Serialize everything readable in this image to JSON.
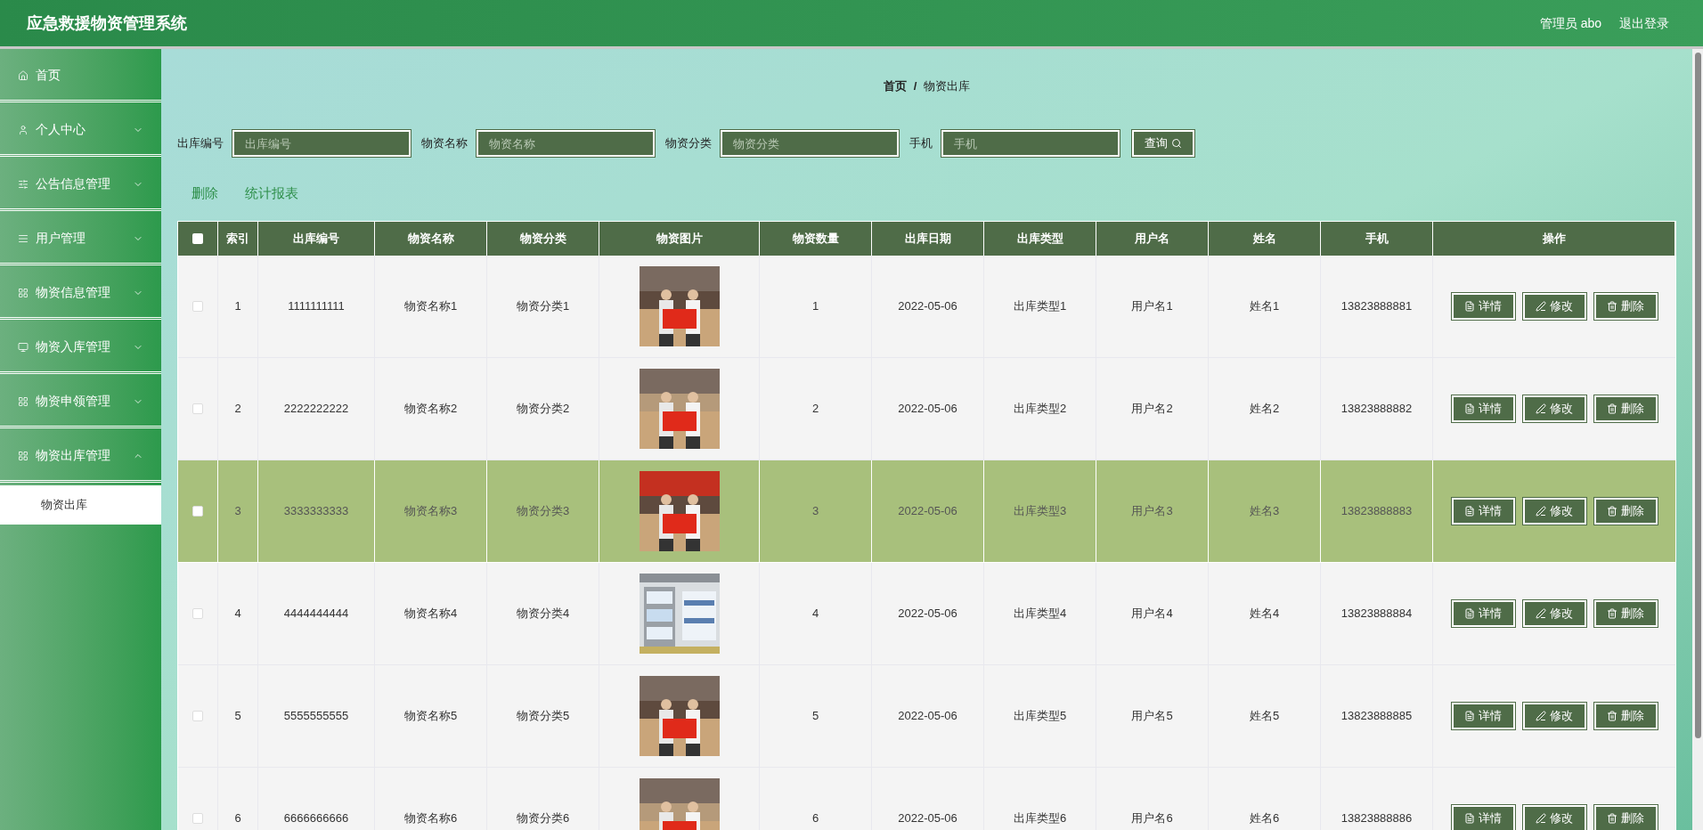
{
  "header": {
    "title": "应急救援物资管理系统",
    "user": "管理员 abo",
    "logout": "退出登录"
  },
  "sidebar": {
    "items": [
      {
        "label": "首页",
        "kind": "link"
      },
      {
        "label": "个人中心",
        "kind": "menu",
        "expanded": false
      },
      {
        "label": "公告信息管理",
        "kind": "menu",
        "expanded": false
      },
      {
        "label": "用户管理",
        "kind": "menu",
        "expanded": false
      },
      {
        "label": "物资信息管理",
        "kind": "menu",
        "expanded": false
      },
      {
        "label": "物资入库管理",
        "kind": "menu",
        "expanded": false
      },
      {
        "label": "物资申领管理",
        "kind": "menu",
        "expanded": false
      },
      {
        "label": "物资出库管理",
        "kind": "menu",
        "expanded": true,
        "children": [
          {
            "label": "物资出库",
            "selected": true
          }
        ]
      }
    ]
  },
  "breadcrumb": {
    "items": [
      "首页",
      "物资出库"
    ],
    "separator": "/"
  },
  "search": {
    "fields": [
      {
        "label": "出库编号",
        "placeholder": "出库编号"
      },
      {
        "label": "物资名称",
        "placeholder": "物资名称"
      },
      {
        "label": "物资分类",
        "placeholder": "物资分类"
      },
      {
        "label": "手机",
        "placeholder": "手机"
      }
    ],
    "button": "查询"
  },
  "actions": [
    "删除",
    "统计报表"
  ],
  "table": {
    "header_checkbox": {
      "checked": false
    },
    "columns": [
      "索引",
      "出库编号",
      "物资名称",
      "物资分类",
      "物资图片",
      "物资数量",
      "出库日期",
      "出库类型",
      "用户名",
      "姓名",
      "手机",
      "操作"
    ],
    "rows": [
      {
        "selected": false,
        "checked": false,
        "cells": [
          "1",
          "1111111111",
          "物资名称1",
          "物资分类1",
          {
            "kind": "picture"
          },
          "1",
          "2022-05-06",
          "出库类型1",
          "用户名1",
          "姓名1",
          "13823888881"
        ],
        "actions": [
          "详情",
          "修改",
          "删除"
        ]
      },
      {
        "selected": false,
        "checked": false,
        "cells": [
          "2",
          "2222222222",
          "物资名称2",
          "物资分类2",
          {
            "kind": "picture"
          },
          "2",
          "2022-05-06",
          "出库类型2",
          "用户名2",
          "姓名2",
          "13823888882"
        ],
        "actions": [
          "详情",
          "修改",
          "删除"
        ]
      },
      {
        "selected": true,
        "checked": false,
        "cells": [
          "3",
          "3333333333",
          "物资名称3",
          "物资分类3",
          {
            "kind": "picture"
          },
          "3",
          "2022-05-06",
          "出库类型3",
          "用户名3",
          "姓名3",
          "13823888883"
        ],
        "actions": [
          "详情",
          "修改",
          "删除"
        ]
      },
      {
        "selected": false,
        "checked": false,
        "cells": [
          "4",
          "4444444444",
          "物资名称4",
          "物资分类4",
          {
            "kind": "picture"
          },
          "4",
          "2022-05-06",
          "出库类型4",
          "用户名4",
          "姓名4",
          "13823888884"
        ],
        "actions": [
          "详情",
          "修改",
          "删除"
        ]
      },
      {
        "selected": false,
        "checked": false,
        "cells": [
          "5",
          "5555555555",
          "物资名称5",
          "物资分类5",
          {
            "kind": "picture"
          },
          "5",
          "2022-05-06",
          "出库类型5",
          "用户名5",
          "姓名5",
          "13823888885"
        ],
        "actions": [
          "详情",
          "修改",
          "删除"
        ]
      },
      {
        "selected": false,
        "checked": false,
        "cells": [
          "6",
          "6666666666",
          "物资名称6",
          "物资分类6",
          {
            "kind": "picture"
          },
          "6",
          "2022-05-06",
          "出库类型6",
          "用户名6",
          "姓名6",
          "13823888886"
        ],
        "actions": [
          "详情",
          "修改",
          "删除"
        ]
      }
    ]
  }
}
